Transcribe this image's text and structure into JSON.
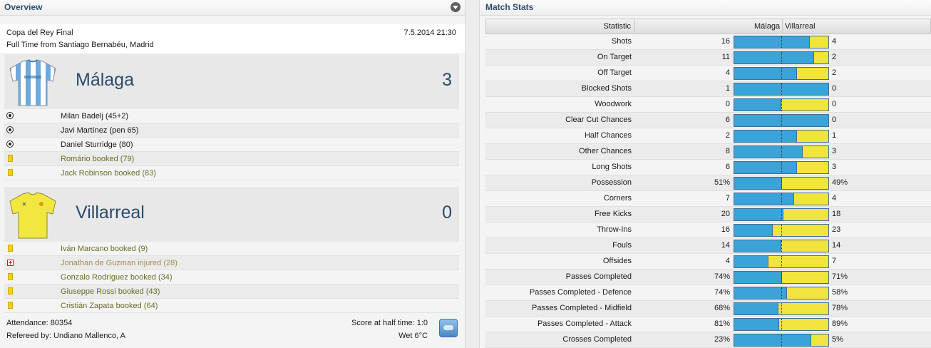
{
  "overview": {
    "title": "Overview",
    "competition": "Copa del Rey Final",
    "datetime": "7.5.2014 21:30",
    "venue": "Full Time from Santiago Bernabéu, Madrid",
    "home": {
      "name": "Málaga",
      "score": "3",
      "events": [
        {
          "type": "goal",
          "text": "Milan Badelj (45+2)"
        },
        {
          "type": "goal",
          "text": "Javi Martínez (pen 65)"
        },
        {
          "type": "goal",
          "text": "Daniel Sturridge (80)"
        },
        {
          "type": "booking",
          "text": "Romário booked (79)"
        },
        {
          "type": "booking",
          "text": "Jack Robinson booked (83)"
        }
      ]
    },
    "away": {
      "name": "Villarreal",
      "score": "0",
      "events": [
        {
          "type": "booking",
          "text": "Iván Marcano booked (9)"
        },
        {
          "type": "injury",
          "text": "Jonathan de Guzman injured (28)"
        },
        {
          "type": "booking",
          "text": "Gonzalo Rodríguez booked (34)"
        },
        {
          "type": "booking",
          "text": "Giuseppe Rossi booked (43)"
        },
        {
          "type": "booking",
          "text": "Cristián Zapata booked (64)"
        }
      ]
    },
    "attendance": "Attendance: 80354",
    "referee": "Refereed by: Undiano Mallenco, A",
    "halftime": "Score at half time: 1:0",
    "weather": "Wet 6°C",
    "weather_icon": "cloud-icon"
  },
  "stats": {
    "title": "Match Stats",
    "header": {
      "statistic": "Statistic",
      "home": "Málaga",
      "away": "Villarreal"
    },
    "colors": {
      "home": "#3aa3d7",
      "away": "#f1e43c"
    },
    "rows": [
      {
        "label": "Shots",
        "home": "16",
        "away": "4",
        "home_share": 0.8
      },
      {
        "label": "On Target",
        "home": "11",
        "away": "2",
        "home_share": 0.846
      },
      {
        "label": "Off Target",
        "home": "4",
        "away": "2",
        "home_share": 0.667
      },
      {
        "label": "Blocked Shots",
        "home": "1",
        "away": "0",
        "home_share": 1.0
      },
      {
        "label": "Woodwork",
        "home": "0",
        "away": "0",
        "home_share": 0.5
      },
      {
        "label": "Clear Cut Chances",
        "home": "6",
        "away": "0",
        "home_share": 1.0
      },
      {
        "label": "Half Chances",
        "home": "2",
        "away": "1",
        "home_share": 0.667
      },
      {
        "label": "Other Chances",
        "home": "8",
        "away": "3",
        "home_share": 0.727
      },
      {
        "label": "Long Shots",
        "home": "6",
        "away": "3",
        "home_share": 0.667
      },
      {
        "label": "Possession",
        "home": "51%",
        "away": "49%",
        "home_share": 0.51
      },
      {
        "label": "Corners",
        "home": "7",
        "away": "4",
        "home_share": 0.636
      },
      {
        "label": "Free Kicks",
        "home": "20",
        "away": "18",
        "home_share": 0.526
      },
      {
        "label": "Throw-Ins",
        "home": "16",
        "away": "23",
        "home_share": 0.41
      },
      {
        "label": "Fouls",
        "home": "14",
        "away": "14",
        "home_share": 0.5
      },
      {
        "label": "Offsides",
        "home": "4",
        "away": "7",
        "home_share": 0.364
      },
      {
        "label": "Passes Completed",
        "home": "74%",
        "away": "71%",
        "home_share": 0.51
      },
      {
        "label": "Passes Completed - Defence",
        "home": "74%",
        "away": "58%",
        "home_share": 0.561
      },
      {
        "label": "Passes Completed - Midfield",
        "home": "68%",
        "away": "78%",
        "home_share": 0.466
      },
      {
        "label": "Passes Completed - Attack",
        "home": "81%",
        "away": "89%",
        "home_share": 0.476
      },
      {
        "label": "Crosses Completed",
        "home": "23%",
        "away": "5%",
        "home_share": 0.821
      }
    ]
  }
}
